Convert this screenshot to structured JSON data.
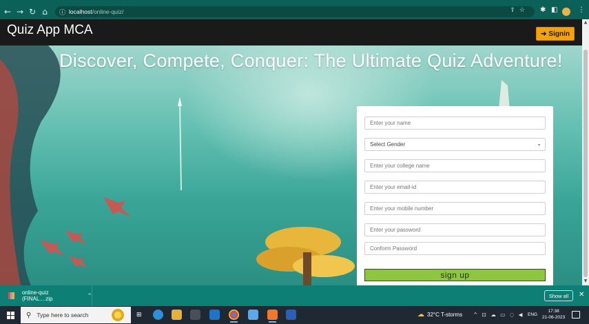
{
  "browser": {
    "url_host": "localhost",
    "url_path": "/online-quiz/",
    "nav_icons": [
      "back-icon",
      "forward-icon",
      "reload-icon",
      "home-icon"
    ],
    "toolbar_icons": [
      "share-icon",
      "star-icon",
      "extension-icon",
      "sidebar-icon",
      "profile-icon",
      "menu-icon"
    ]
  },
  "app": {
    "brand": "Quiz App MCA",
    "signin_label": "Signin",
    "accent": "#f4a20c"
  },
  "hero": {
    "title": "Discover, Compete, Conquer: The Ultimate Quiz Adventure!"
  },
  "form": {
    "name_placeholder": "Enter your name",
    "gender_selected": "Select Gender",
    "college_placeholder": "Enter your college name",
    "email_placeholder": "Enter your email-id",
    "mobile_placeholder": "Enter your mobile number",
    "password_placeholder": "Enter your password",
    "confirm_placeholder": "Conform Password",
    "signup_label": "sign up",
    "signup_color": "#8ec63f"
  },
  "downloads": {
    "file_name": "online-quiz (FINAL....zip",
    "show_all_label": "Show all"
  },
  "taskbar": {
    "search_placeholder": "Type here to search",
    "weather": "32°C  T-storms",
    "language": "ENG",
    "time": "17:38",
    "date": "21-06-2023"
  }
}
